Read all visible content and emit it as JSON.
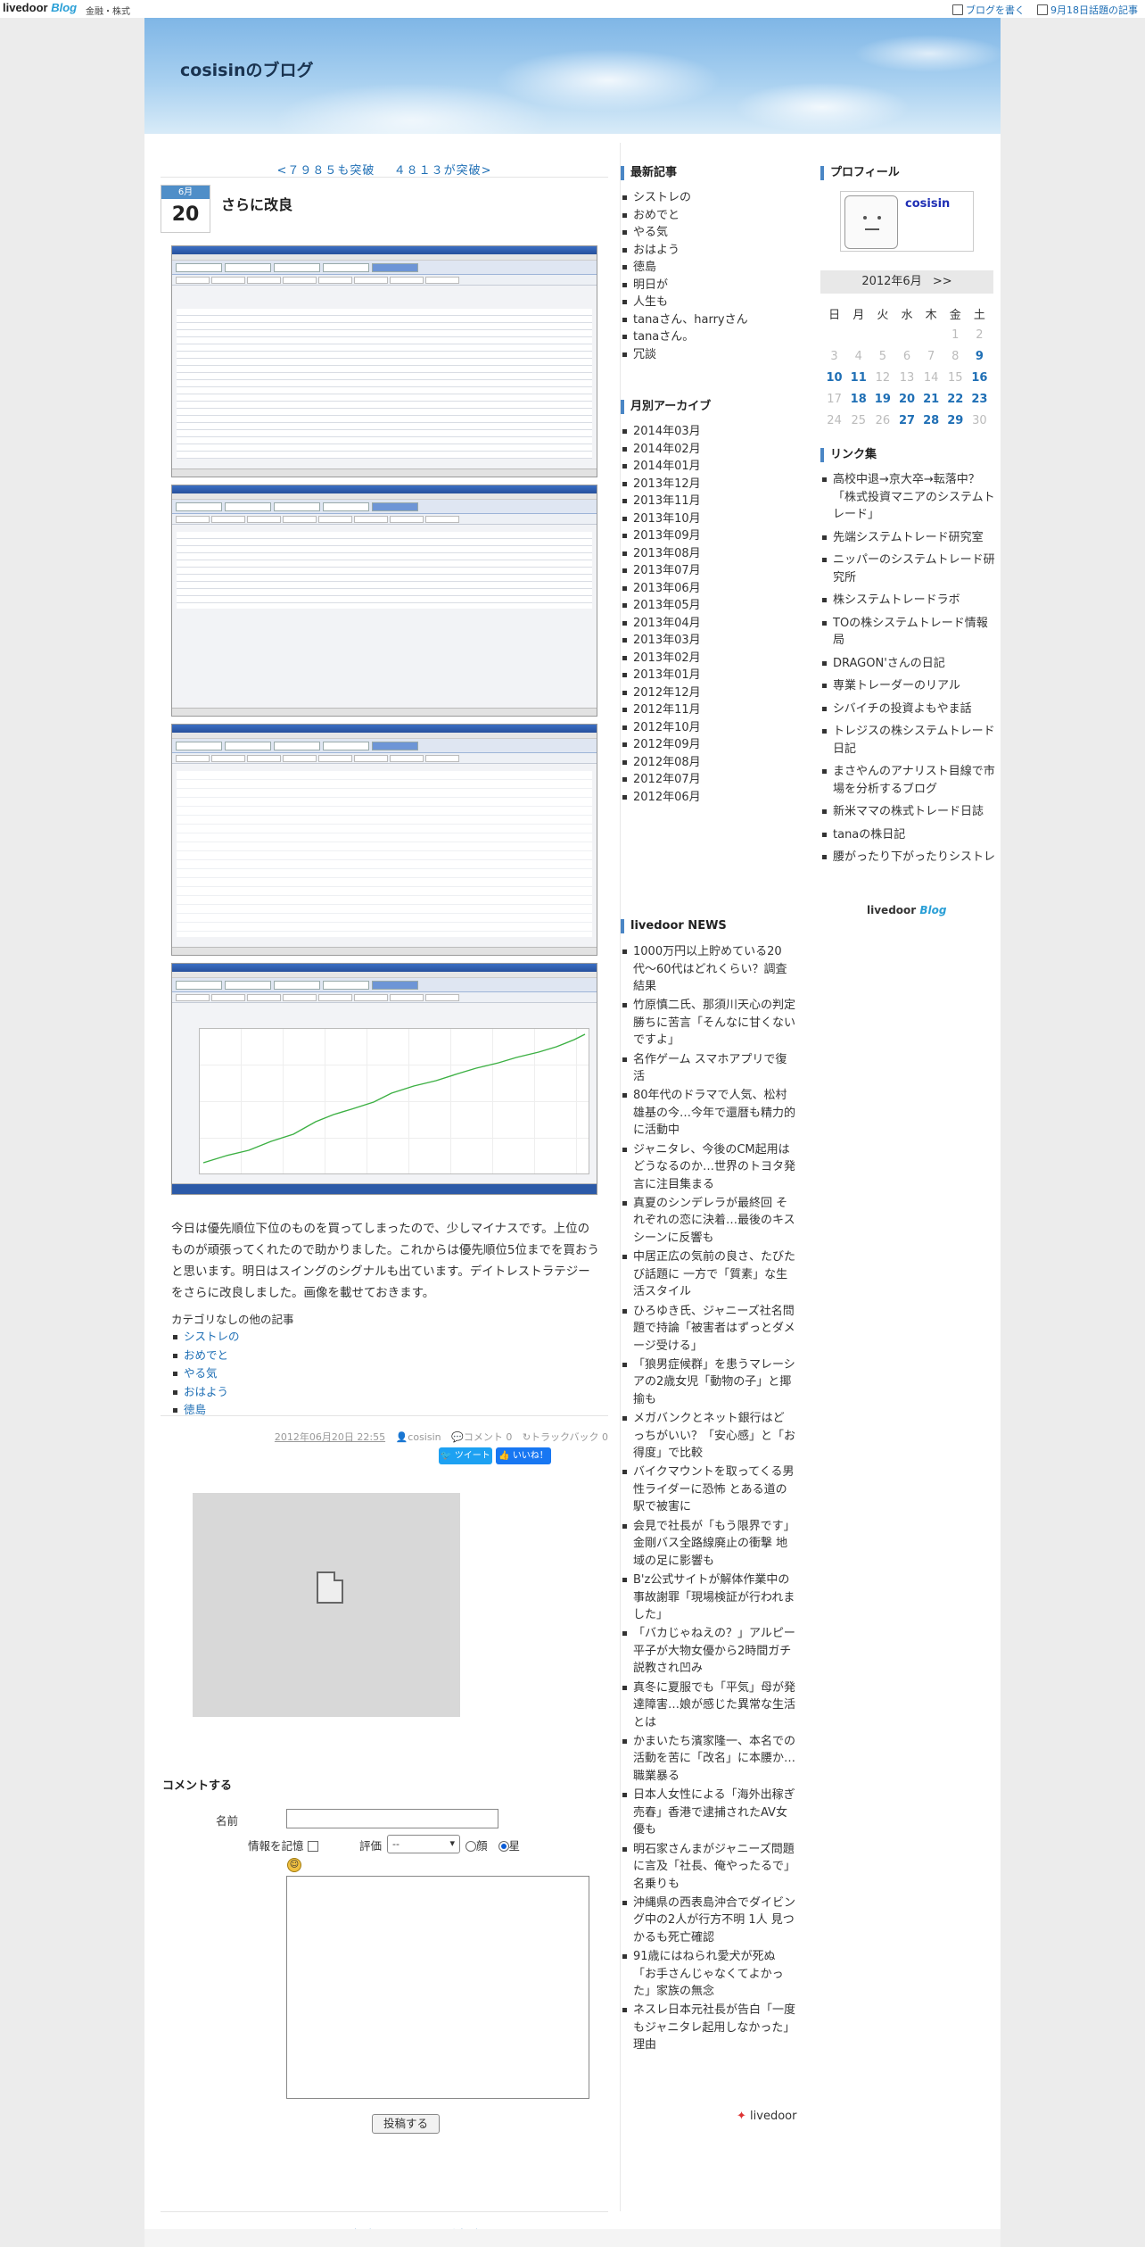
{
  "topbar": {
    "logo_main": "livedoor",
    "logo_blog": "Blog",
    "category": "金融・株式",
    "write_blog": "ブログを書く",
    "trending": "9月18日話題の記事"
  },
  "blog": {
    "title": "cosisinのブログ"
  },
  "pager": {
    "prev": "<７９８５も突破",
    "next": "４８１３が突破>"
  },
  "post": {
    "month": "6月",
    "day": "20",
    "title": "さらに改良",
    "body": "今日は優先順位下位のものを買ってしまったので、少しマイナスです。上位のものが頑張ってくれたので助かりました。これからは優先順位5位までを買おうと思います。明日はスイングのシグナルも出ています。デイトレストラテジーをさらに改良しました。画像を載せておきます。",
    "other_posts_heading": "カテゴリなしの他の記事",
    "other_posts": [
      "シストレの",
      "おめでと",
      "やる気",
      "おはよう",
      "徳島"
    ],
    "meta_datetime": "2012年06月20日 22:55",
    "meta_author": "cosisin",
    "meta_comments": "コメント 0",
    "meta_trackbacks": "トラックバック 0",
    "tweet_label": "ツイート",
    "like_label": "いいね！ 0"
  },
  "comment_form": {
    "heading": "コメントする",
    "name_label": "名前",
    "remember_label": "情報を記憶",
    "rating_label": "評価",
    "rating_value": "--",
    "face_label": "顔",
    "star_label": "星",
    "submit_label": "投稿する"
  },
  "recent": {
    "heading": "最新記事",
    "items": [
      "シストレの",
      "おめでと",
      "やる気",
      "おはよう",
      "徳島",
      "明日が",
      "人生も",
      "tanaさん、harryさん",
      "tanaさん。",
      "冗談"
    ]
  },
  "archive": {
    "heading": "月別アーカイブ",
    "items": [
      "2014年03月",
      "2014年02月",
      "2014年01月",
      "2013年12月",
      "2013年11月",
      "2013年10月",
      "2013年09月",
      "2013年08月",
      "2013年07月",
      "2013年06月",
      "2013年05月",
      "2013年04月",
      "2013年03月",
      "2013年02月",
      "2013年01月",
      "2012年12月",
      "2012年11月",
      "2012年10月",
      "2012年09月",
      "2012年08月",
      "2012年07月",
      "2012年06月"
    ]
  },
  "news": {
    "heading": "livedoor NEWS",
    "items": [
      "1000万円以上貯めている20代〜60代はどれくらい？調査結果",
      "竹原慎二氏、那須川天心の判定勝ちに苦言「そんなに甘くないですよ」",
      "名作ゲーム スマホアプリで復活",
      "80年代のドラマで人気、松村雄基の今…今年で還暦も精力的に活動中",
      "ジャニタレ、今後のCM起用はどうなるのか…世界のトヨタ発言に注目集まる",
      "真夏のシンデレラが最終回 それぞれの恋に決着…最後のキスシーンに反響も",
      "中居正広の気前の良さ、たびたび話題に 一方で「質素」な生活スタイル",
      "ひろゆき氏、ジャニーズ社名問題で持論「被害者はずっとダメージ受ける」",
      "「狼男症候群」を患うマレーシアの2歳女児「動物の子」と揶揄も",
      "メガバンクとネット銀行はどっちがいい？「安心感」と「お得度」で比較",
      "バイクマウントを取ってくる男性ライダーに恐怖 とある道の駅で被害に",
      "会見で社長が「もう限界です」金剛バス全路線廃止の衝撃 地域の足に影響も",
      "B'z公式サイトが解体作業中の事故謝罪「現場検証が行われました」",
      "「バカじゃねえの？」アルピー平子が大物女優から2時間ガチ説教され凹み",
      "真冬に夏服でも「平気」母が発達障害…娘が感じた異常な生活とは",
      "かまいたち濱家隆一、本名での活動を苦に「改名」に本腰か…職業暴る",
      "日本人女性による「海外出稼ぎ売春」香港で逮捕されたAV女優も",
      "明石家さんまがジャニーズ問題に言及「社長、俺やったるで」名乗りも",
      "沖縄県の西表島沖合でダイビング中の2人が行方不明 1人 見つかるも死亡確認",
      "91歳にはねられ愛犬が死ぬ「お手さんじゃなくてよかった」家族の無念",
      "ネスレ日本元社長が告白「一度もジャニタレ起用しなかった」理由"
    ],
    "footer": "livedoor"
  },
  "profile": {
    "heading": "プロフィール",
    "name": "cosisin"
  },
  "calendar": {
    "title": "2012年6月",
    "next": ">>",
    "weekdays": [
      "日",
      "月",
      "火",
      "水",
      "木",
      "金",
      "土"
    ],
    "weeks": [
      [
        "",
        "",
        "",
        "",
        "",
        "1",
        "2"
      ],
      [
        "3",
        "4",
        "5",
        "6",
        "7",
        "8",
        "9"
      ],
      [
        "10",
        "11",
        "12",
        "13",
        "14",
        "15",
        "16"
      ],
      [
        "17",
        "18",
        "19",
        "20",
        "21",
        "22",
        "23"
      ],
      [
        "24",
        "25",
        "26",
        "27",
        "28",
        "29",
        "30"
      ]
    ],
    "linked_days": [
      "9",
      "10",
      "11",
      "16",
      "18",
      "19",
      "20",
      "21",
      "22",
      "23",
      "27",
      "28",
      "29"
    ]
  },
  "links": {
    "heading": "リンク集",
    "items": [
      "高校中退→京大卒→転落中？「株式投資マニアのシステムトレード」",
      "先端システムトレード研究室",
      "ニッパーのシステムトレード研究所",
      "株システムトレードラボ",
      "TOの株システムトレード情報局",
      "DRAGON'さんの日記",
      "専業トレーダーのリアル",
      "シバイチの投資よもやま話",
      "トレジスの株システムトレード日記",
      "まさやんのアナリスト目線で市場を分析するブログ",
      "新米ママの株式トレード日誌",
      "tanaの株日記",
      "腰がったり下がったりシストレ"
    ]
  },
  "footer_badge": {
    "main": "livedoor",
    "blog": "Blog"
  }
}
